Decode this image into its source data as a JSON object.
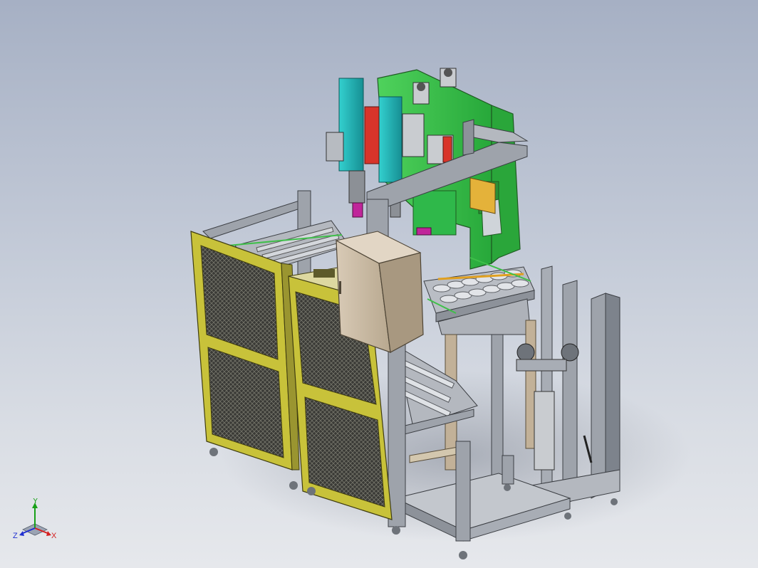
{
  "viewport": {
    "background_top": "#a6b0c4",
    "background_bottom": "#e6e8ec"
  },
  "model": {
    "frame_color": "#9ea3ab",
    "press_color": "#33c24a",
    "guard_color": "#c8c23a",
    "cabinet_color": "#c9b9a4",
    "cylinder_color": "#21b3b3",
    "roller_color": "#c8ccd2",
    "accent_red": "#d8342a",
    "accent_magenta": "#c0259a",
    "accent_orange": "#e0a020"
  },
  "triad": {
    "x_label": "X",
    "y_label": "Y",
    "z_label": "Z",
    "x_color": "#d42020",
    "y_color": "#18a018",
    "z_color": "#2030d0"
  }
}
